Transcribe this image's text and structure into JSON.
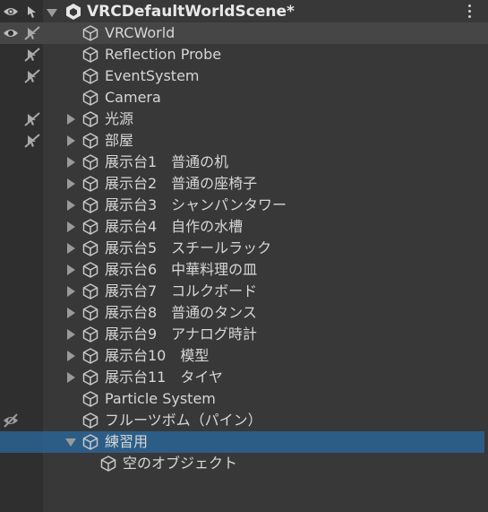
{
  "scene": {
    "title": "VRCDefaultWorldScene*"
  },
  "rows": [
    {
      "label": "VRCWorld",
      "depth": 0,
      "arrow": "none",
      "vis": "eye",
      "pick": "crossed",
      "highlight": true
    },
    {
      "label": "Reflection Probe",
      "depth": 0,
      "arrow": "none",
      "vis": "none",
      "pick": "crossed"
    },
    {
      "label": "EventSystem",
      "depth": 0,
      "arrow": "none",
      "vis": "none",
      "pick": "crossed"
    },
    {
      "label": "Camera",
      "depth": 0,
      "arrow": "none",
      "vis": "none",
      "pick": "none"
    },
    {
      "label": "光源",
      "depth": 0,
      "arrow": "right",
      "vis": "none",
      "pick": "crossed"
    },
    {
      "label": "部屋",
      "depth": 0,
      "arrow": "right",
      "vis": "none",
      "pick": "crossed"
    },
    {
      "label": "展示台1　普通の机",
      "depth": 0,
      "arrow": "right",
      "vis": "none",
      "pick": "none"
    },
    {
      "label": "展示台2　普通の座椅子",
      "depth": 0,
      "arrow": "right",
      "vis": "none",
      "pick": "none"
    },
    {
      "label": "展示台3　シャンパンタワー",
      "depth": 0,
      "arrow": "right",
      "vis": "none",
      "pick": "none"
    },
    {
      "label": "展示台4　自作の水槽",
      "depth": 0,
      "arrow": "right",
      "vis": "none",
      "pick": "none"
    },
    {
      "label": "展示台5　スチールラック",
      "depth": 0,
      "arrow": "right",
      "vis": "none",
      "pick": "none"
    },
    {
      "label": "展示台6　中華料理の皿",
      "depth": 0,
      "arrow": "right",
      "vis": "none",
      "pick": "none"
    },
    {
      "label": "展示台7　コルクボード",
      "depth": 0,
      "arrow": "right",
      "vis": "none",
      "pick": "none"
    },
    {
      "label": "展示台8　普通のタンス",
      "depth": 0,
      "arrow": "right",
      "vis": "none",
      "pick": "none"
    },
    {
      "label": "展示台9　アナログ時計",
      "depth": 0,
      "arrow": "right",
      "vis": "none",
      "pick": "none"
    },
    {
      "label": "展示台10　模型",
      "depth": 0,
      "arrow": "right",
      "vis": "none",
      "pick": "none"
    },
    {
      "label": "展示台11　タイヤ",
      "depth": 0,
      "arrow": "right",
      "vis": "none",
      "pick": "none"
    },
    {
      "label": "Particle System",
      "depth": 0,
      "arrow": "none",
      "vis": "none",
      "pick": "none"
    },
    {
      "label": "フルーツボム（パイン）",
      "depth": 0,
      "arrow": "none",
      "vis": "eye-crossed",
      "pick": "none"
    },
    {
      "label": "練習用",
      "depth": 0,
      "arrow": "down",
      "vis": "none",
      "pick": "none",
      "selected": true
    },
    {
      "label": "空のオブジェクト",
      "depth": 1,
      "arrow": "none",
      "vis": "none",
      "pick": "none"
    }
  ],
  "icons": {
    "scene": "unity-logo-icon",
    "object": "gameobject-cube-icon",
    "visibility": "eye-icon",
    "picking": "pointer-hand-icon",
    "menu": "kebab-menu-icon"
  },
  "colors": {
    "background": "#383838",
    "gutter": "#2f2f2f",
    "selection": "#2c5d87",
    "hover": "#464646",
    "text": "#d6d6d6"
  }
}
